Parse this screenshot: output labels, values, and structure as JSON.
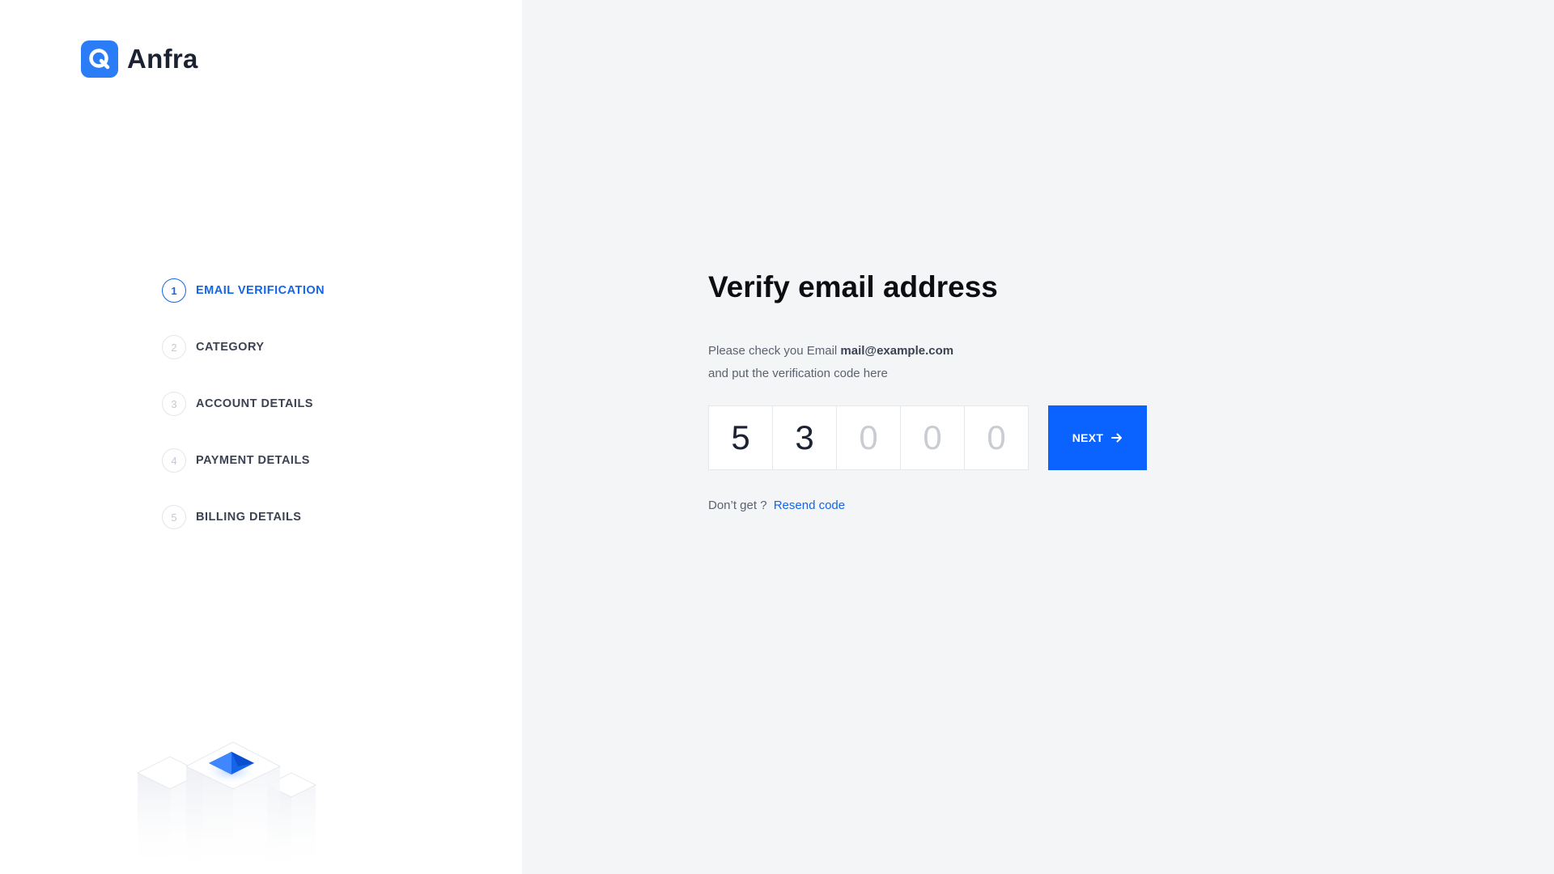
{
  "brand": {
    "name": "Anfra",
    "icon": "logo-q-icon",
    "accent": "#2a7cf7"
  },
  "steps": [
    {
      "number": "1",
      "label": "EMAIL VERIFICATION",
      "active": true
    },
    {
      "number": "2",
      "label": "CATEGORY",
      "active": false
    },
    {
      "number": "3",
      "label": "ACCOUNT DETAILS",
      "active": false
    },
    {
      "number": "4",
      "label": "PAYMENT DETAILS",
      "active": false
    },
    {
      "number": "5",
      "label": "BILLING DETAILS",
      "active": false
    }
  ],
  "main": {
    "title": "Verify email address",
    "desc_prefix": "Please check you Email",
    "email": "mail@example.com",
    "desc_suffix": "and put the verification code here",
    "code": [
      {
        "value": "5",
        "filled": true
      },
      {
        "value": "3",
        "filled": true
      },
      {
        "value": "0",
        "filled": false
      },
      {
        "value": "0",
        "filled": false
      },
      {
        "value": "0",
        "filled": false
      }
    ],
    "next_label": "NEXT",
    "next_icon": "arrow-right-icon",
    "resend_prompt": "Don’t get ?",
    "resend_link": "Resend code"
  },
  "colors": {
    "primary_button": "#0a63ff",
    "active_step": "#1565e8",
    "page_background": "#f4f5f7"
  }
}
